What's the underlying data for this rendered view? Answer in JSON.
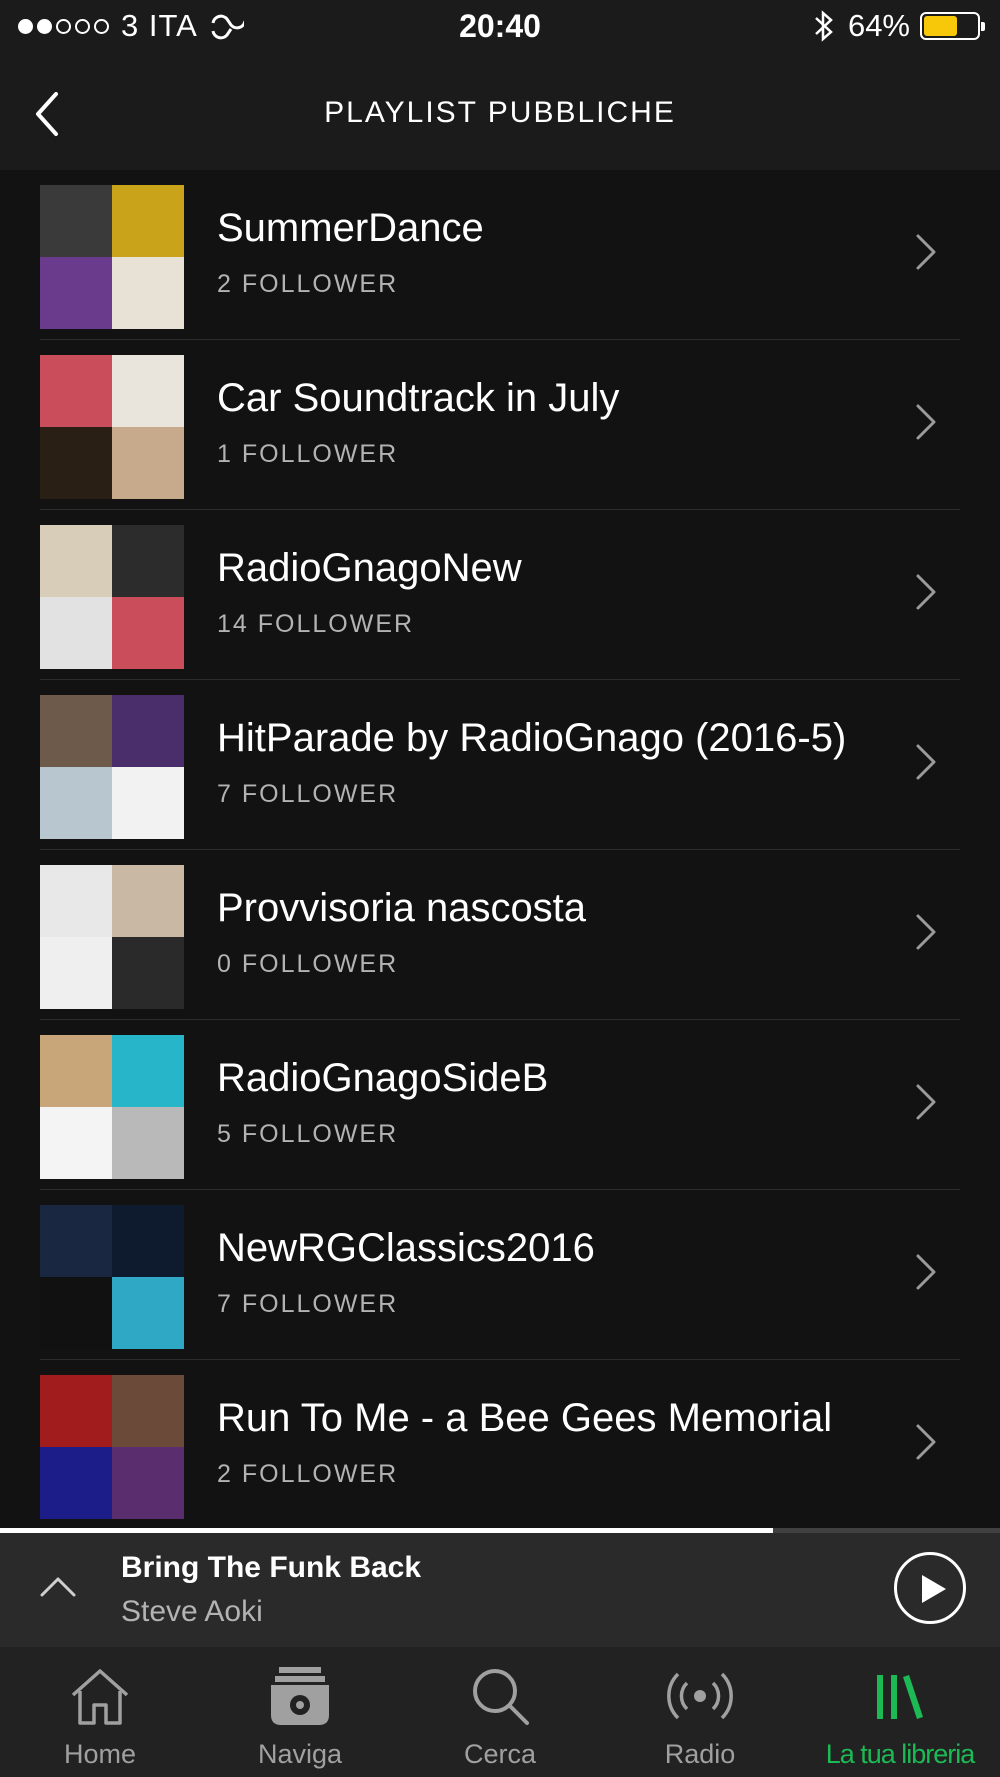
{
  "status_bar": {
    "carrier": "3 ITA",
    "time": "20:40",
    "battery": "64%",
    "battery_level": 0.64,
    "signal_bars_filled": 2,
    "signal_bars_total": 5
  },
  "header": {
    "title": "PLAYLIST PUBBLICHE"
  },
  "playlists": [
    {
      "name": "SummerDance",
      "followers": "2 FOLLOWER",
      "cover_colors": [
        "#3a3a3a",
        "#c9a31a",
        "#6a3b8c",
        "#e8e2d6"
      ]
    },
    {
      "name": "Car Soundtrack in July",
      "followers": "1 FOLLOWER",
      "cover_colors": [
        "#c94d5a",
        "#e9e4dc",
        "#2a1f14",
        "#c7a98b"
      ]
    },
    {
      "name": "RadioGnagoNew",
      "followers": "14 FOLLOWER",
      "cover_colors": [
        "#d8cdb8",
        "#2c2c2c",
        "#e2e2e2",
        "#c94d5a"
      ]
    },
    {
      "name": "HitParade by RadioGnago (2016-5)",
      "followers": "7 FOLLOWER",
      "cover_colors": [
        "#6d5a4a",
        "#4a2d6b",
        "#b8c6cf",
        "#f2f2f2"
      ]
    },
    {
      "name": "Provvisoria nascosta",
      "followers": "0 FOLLOWER",
      "cover_colors": [
        "#e8e8e8",
        "#c8b8a4",
        "#efefef",
        "#2a2a2a"
      ]
    },
    {
      "name": "RadioGnagoSideB",
      "followers": "5 FOLLOWER",
      "cover_colors": [
        "#c9a57a",
        "#27b6c9",
        "#f4f4f4",
        "#b9b9b9"
      ]
    },
    {
      "name": "NewRGClassics2016",
      "followers": "7 FOLLOWER",
      "cover_colors": [
        "#1a2740",
        "#0e1a2e",
        "#111111",
        "#2ea8c4"
      ]
    },
    {
      "name": "Run To Me - a Bee Gees Memorial",
      "followers": "2 FOLLOWER",
      "cover_colors": [
        "#a11d1d",
        "#6b4a3a",
        "#1d1d8a",
        "#5a2d6e"
      ]
    }
  ],
  "now_playing": {
    "title": "Bring The Funk Back",
    "artist": "Steve Aoki",
    "progress": 0.773
  },
  "tabs": [
    {
      "label": "Home",
      "icon": "home-icon",
      "active": false
    },
    {
      "label": "Naviga",
      "icon": "browse-icon",
      "active": false
    },
    {
      "label": "Cerca",
      "icon": "search-icon",
      "active": false
    },
    {
      "label": "Radio",
      "icon": "radio-icon",
      "active": false
    },
    {
      "label": "La tua libreria",
      "icon": "library-icon",
      "active": true
    }
  ],
  "colors": {
    "accent": "#1db954",
    "background": "#121212",
    "battery": "#f7c70a"
  }
}
